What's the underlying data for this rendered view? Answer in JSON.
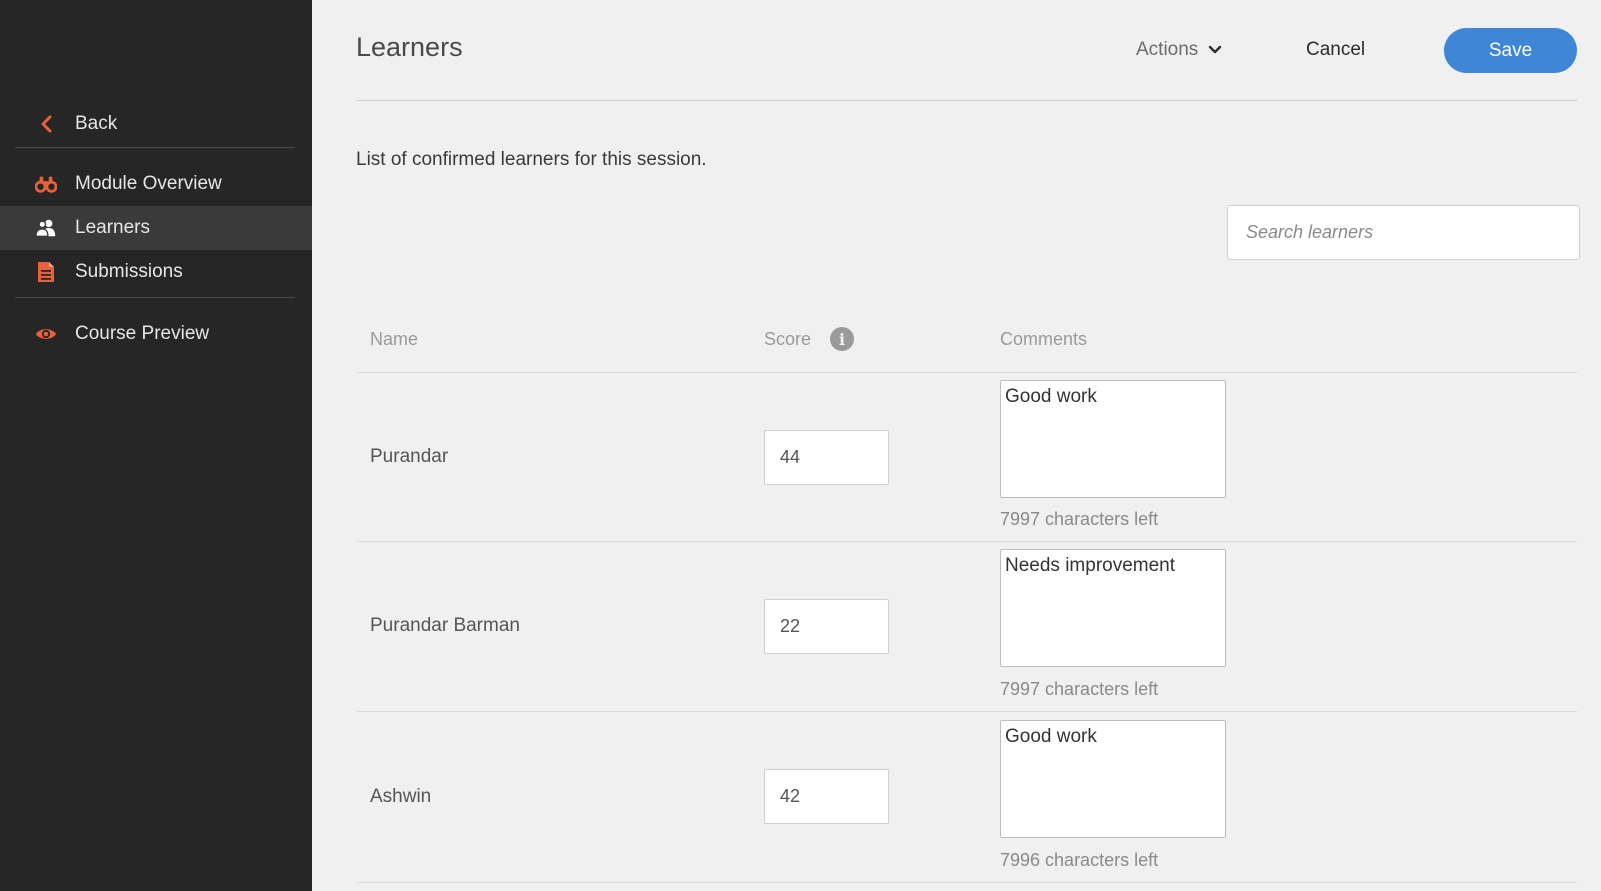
{
  "sidebar": {
    "back_label": "Back",
    "items": [
      {
        "label": "Module Overview",
        "icon": "binoculars-icon"
      },
      {
        "label": "Learners",
        "icon": "users-icon",
        "active": true
      },
      {
        "label": "Submissions",
        "icon": "document-icon"
      },
      {
        "label": "Course Preview",
        "icon": "eye-icon"
      }
    ],
    "accent_color": "#e8613c"
  },
  "header": {
    "title": "Learners",
    "actions_label": "Actions",
    "cancel_label": "Cancel",
    "save_label": "Save",
    "save_color": "#3f86d6"
  },
  "main": {
    "description": "List of confirmed learners for this session.",
    "search_placeholder": "Search learners",
    "columns": {
      "name": "Name",
      "score": "Score",
      "comments": "Comments"
    },
    "learners": [
      {
        "name": "Purandar",
        "score": "44",
        "comment": "Good work",
        "chars_left": "7997 characters left"
      },
      {
        "name": "Purandar Barman",
        "score": "22",
        "comment": "Needs improvement",
        "chars_left": "7997 characters left"
      },
      {
        "name": "Ashwin",
        "score": "42",
        "comment": "Good work",
        "chars_left": "7996 characters left"
      }
    ]
  }
}
